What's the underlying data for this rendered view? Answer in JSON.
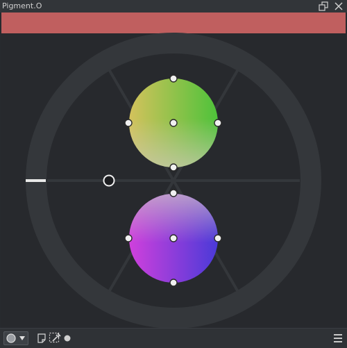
{
  "window": {
    "title": "Pigment.O",
    "float_icon": "float-window-icon",
    "close_icon": "close-window-icon"
  },
  "colors": {
    "active_swatch": "#c05f5f",
    "background": "#27292d",
    "ring": "#36393d",
    "panel": "#2f3236"
  },
  "harmony": {
    "top_disc": {
      "hue_range": "yellow-green",
      "center": "#8cc85a"
    },
    "bottom_disc": {
      "hue_range": "magenta-violet",
      "center": "#a860d8"
    }
  },
  "toolbar": {
    "mode_icon": "circle-mode-icon",
    "dropdown_icon": "chevron-down-icon",
    "new_doc_icon": "document-icon",
    "picker_icon": "selection-eyedropper-icon",
    "dot_icon": "dot-icon",
    "menu_icon": "hamburger-menu-icon"
  }
}
